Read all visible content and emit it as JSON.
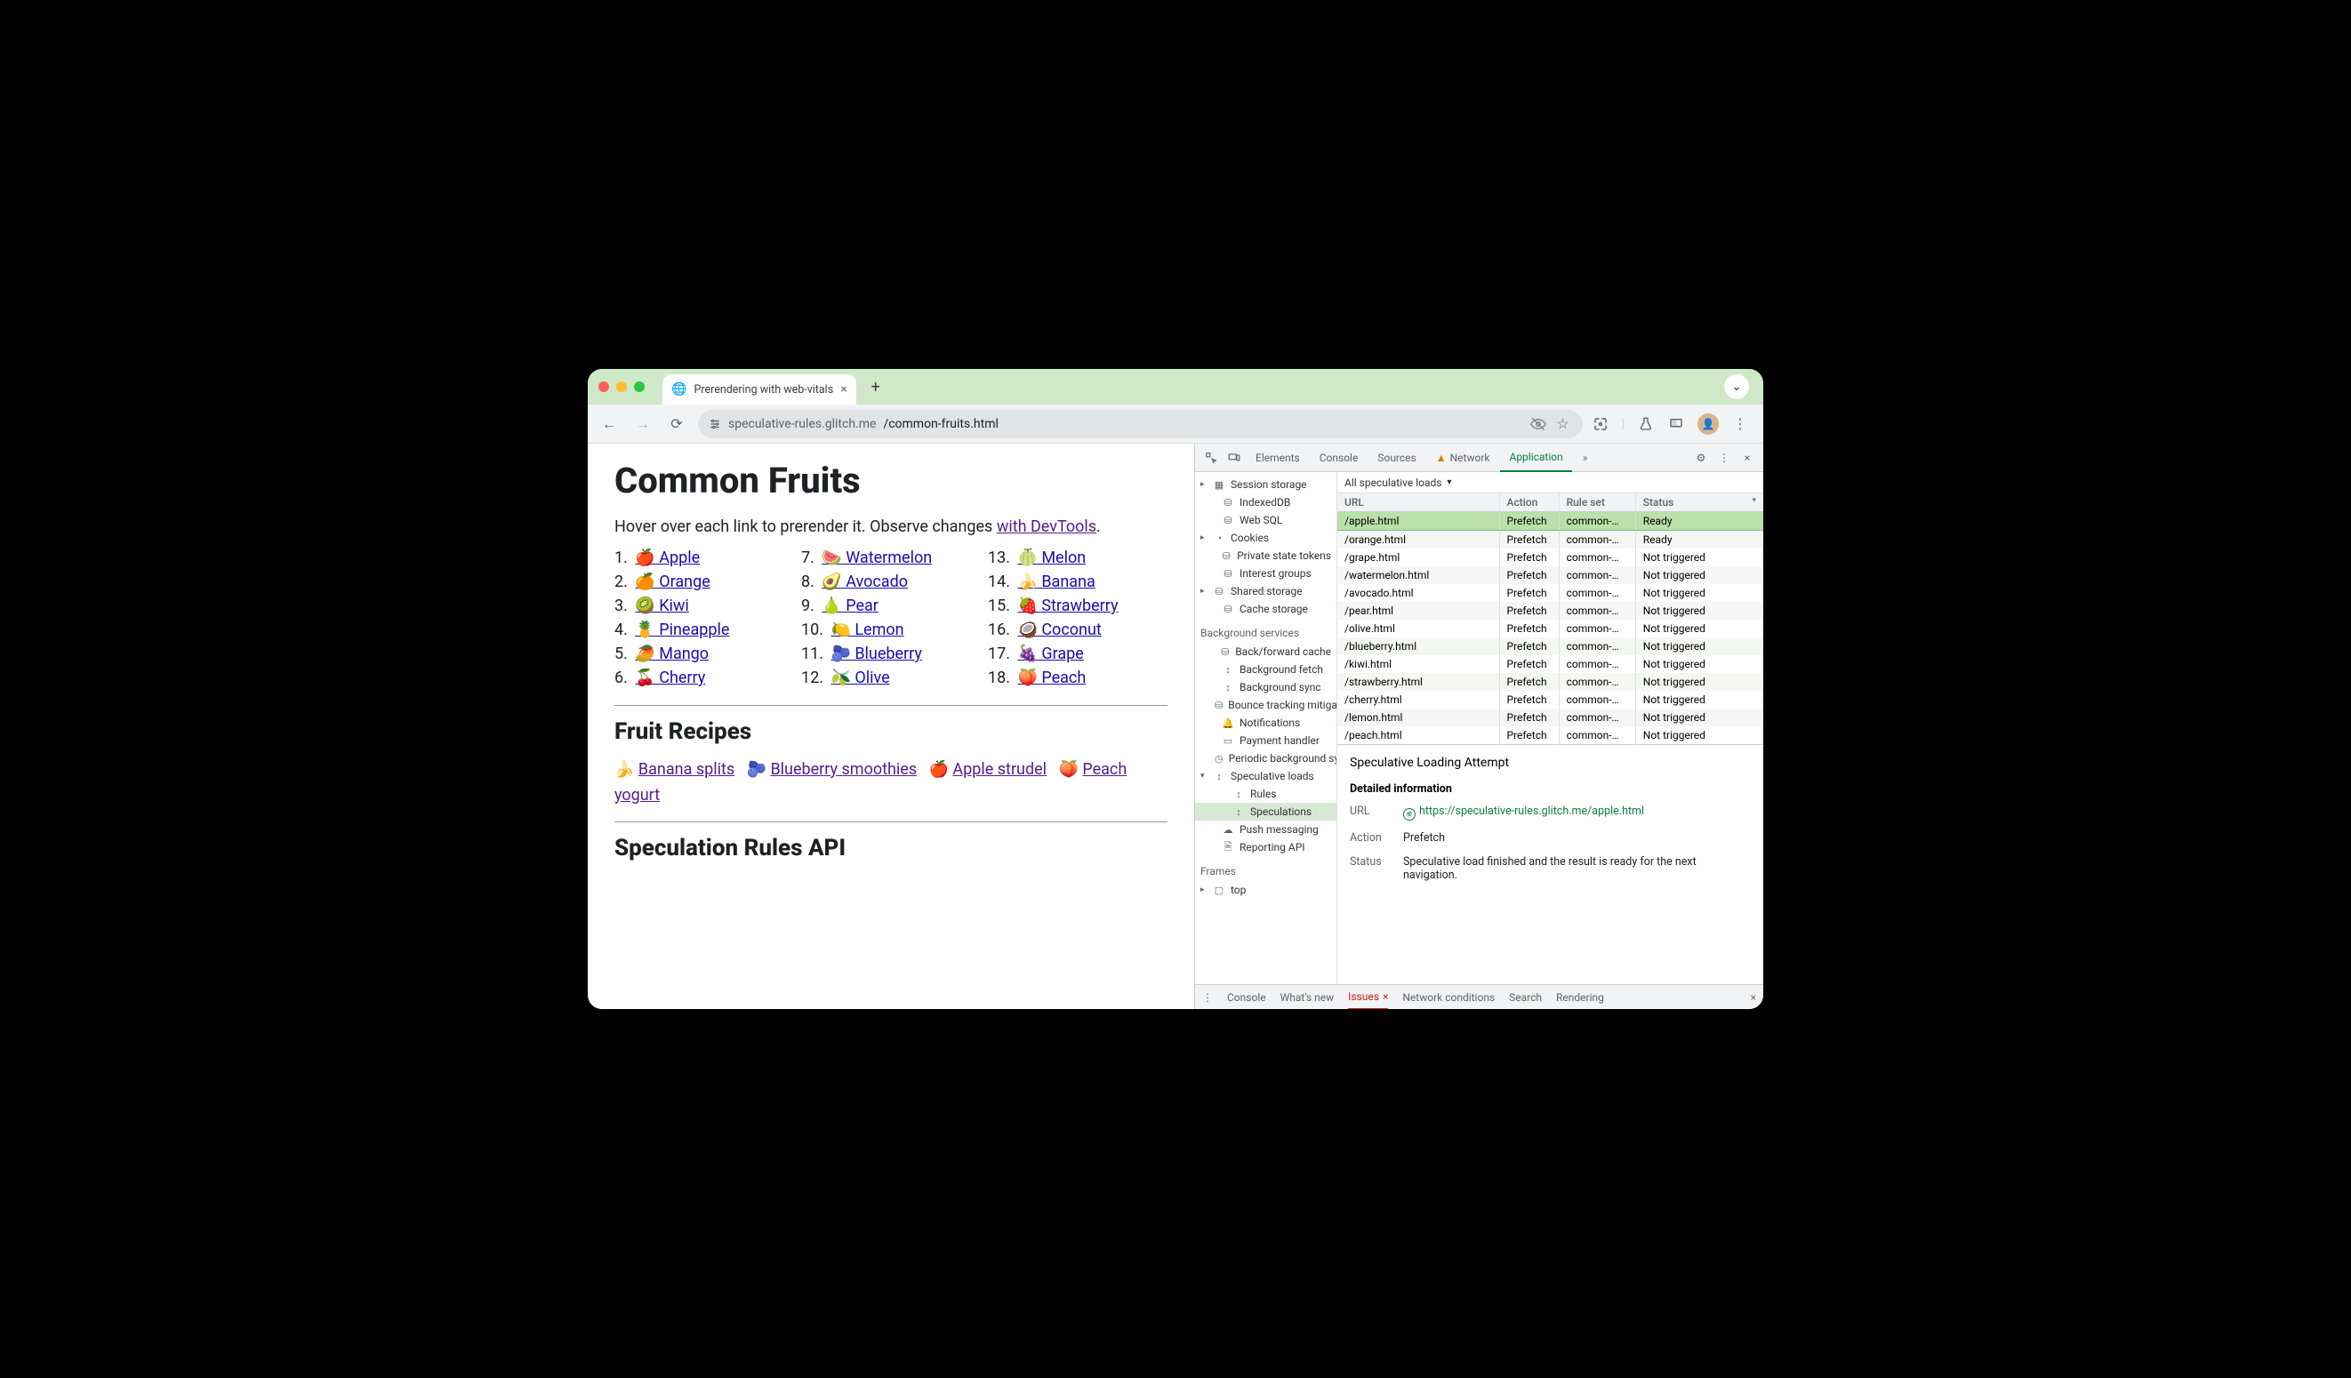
{
  "window": {
    "tab_title": "Prerendering with web-vitals",
    "url_prefix": "speculative-rules.glitch.me",
    "url_path": "/common-fruits.html"
  },
  "page": {
    "h1": "Common Fruits",
    "intro_a": "Hover over each link to prerender it. Observe changes ",
    "intro_link": "with DevTools",
    "intro_b": ".",
    "fruits": [
      {
        "n": "1.",
        "e": "🍎",
        "t": "Apple"
      },
      {
        "n": "2.",
        "e": "🍊",
        "t": "Orange"
      },
      {
        "n": "3.",
        "e": "🥝",
        "t": "Kiwi"
      },
      {
        "n": "4.",
        "e": "🍍",
        "t": "Pineapple"
      },
      {
        "n": "5.",
        "e": "🥭",
        "t": "Mango"
      },
      {
        "n": "6.",
        "e": "🍒",
        "t": "Cherry"
      },
      {
        "n": "7.",
        "e": "🍉",
        "t": "Watermelon"
      },
      {
        "n": "8.",
        "e": "🥑",
        "t": "Avocado"
      },
      {
        "n": "9.",
        "e": "🍐",
        "t": "Pear"
      },
      {
        "n": "10.",
        "e": "🍋",
        "t": "Lemon"
      },
      {
        "n": "11.",
        "e": "🫐",
        "t": "Blueberry"
      },
      {
        "n": "12.",
        "e": "🫒",
        "t": "Olive"
      },
      {
        "n": "13.",
        "e": "🍈",
        "t": "Melon"
      },
      {
        "n": "14.",
        "e": "🍌",
        "t": "Banana"
      },
      {
        "n": "15.",
        "e": "🍓",
        "t": "Strawberry"
      },
      {
        "n": "16.",
        "e": "🥥",
        "t": "Coconut"
      },
      {
        "n": "17.",
        "e": "🍇",
        "t": "Grape"
      },
      {
        "n": "18.",
        "e": "🍑",
        "t": "Peach"
      }
    ],
    "h2_recipes": "Fruit Recipes",
    "recipes": [
      {
        "e": "🍌",
        "t": "Banana splits"
      },
      {
        "e": "🫐",
        "t": "Blueberry smoothies"
      },
      {
        "e": "🍎",
        "t": "Apple strudel"
      },
      {
        "e": "🍑",
        "t": "Peach yogurt"
      }
    ],
    "h2_spec": "Speculation Rules API"
  },
  "devtools": {
    "tabs": {
      "elements": "Elements",
      "console": "Console",
      "sources": "Sources",
      "network": "Network",
      "application": "Application",
      "more": "»"
    },
    "side": [
      {
        "lvl": 0,
        "caret": "▸",
        "icon": "grid",
        "label": "Session storage"
      },
      {
        "lvl": 1,
        "icon": "db",
        "label": "IndexedDB"
      },
      {
        "lvl": 1,
        "icon": "db",
        "label": "Web SQL"
      },
      {
        "lvl": 0,
        "caret": "▸",
        "icon": "cookie",
        "label": "Cookies"
      },
      {
        "lvl": 1,
        "icon": "db",
        "label": "Private state tokens"
      },
      {
        "lvl": 1,
        "icon": "db",
        "label": "Interest groups"
      },
      {
        "lvl": 0,
        "caret": "▸",
        "icon": "db",
        "label": "Shared storage"
      },
      {
        "lvl": 1,
        "icon": "db",
        "label": "Cache storage"
      }
    ],
    "bg_heading": "Background services",
    "bg": [
      {
        "icon": "db",
        "label": "Back/forward cache"
      },
      {
        "icon": "sync",
        "label": "Background fetch"
      },
      {
        "icon": "sync",
        "label": "Background sync"
      },
      {
        "icon": "db",
        "label": "Bounce tracking mitigations"
      },
      {
        "icon": "bell",
        "label": "Notifications"
      },
      {
        "icon": "card",
        "label": "Payment handler"
      },
      {
        "icon": "clock",
        "label": "Periodic background sync"
      }
    ],
    "spec_parent": "Speculative loads",
    "spec_children": [
      "Rules",
      "Speculations"
    ],
    "after": [
      {
        "icon": "cloud",
        "label": "Push messaging"
      },
      {
        "icon": "doc",
        "label": "Reporting API"
      }
    ],
    "frames_heading": "Frames",
    "frames_top": "top",
    "filter_label": "All speculative loads",
    "columns": [
      "URL",
      "Action",
      "Rule set",
      "Status"
    ],
    "rows": [
      {
        "url": "/apple.html",
        "action": "Prefetch",
        "rule": "common-…",
        "status": "Ready",
        "sel": true
      },
      {
        "url": "/orange.html",
        "action": "Prefetch",
        "rule": "common-…",
        "status": "Ready"
      },
      {
        "url": "/grape.html",
        "action": "Prefetch",
        "rule": "common-…",
        "status": "Not triggered"
      },
      {
        "url": "/watermelon.html",
        "action": "Prefetch",
        "rule": "common-…",
        "status": "Not triggered"
      },
      {
        "url": "/avocado.html",
        "action": "Prefetch",
        "rule": "common-…",
        "status": "Not triggered"
      },
      {
        "url": "/pear.html",
        "action": "Prefetch",
        "rule": "common-…",
        "status": "Not triggered"
      },
      {
        "url": "/olive.html",
        "action": "Prefetch",
        "rule": "common-…",
        "status": "Not triggered"
      },
      {
        "url": "/blueberry.html",
        "action": "Prefetch",
        "rule": "common-…",
        "status": "Not triggered"
      },
      {
        "url": "/kiwi.html",
        "action": "Prefetch",
        "rule": "common-…",
        "status": "Not triggered"
      },
      {
        "url": "/strawberry.html",
        "action": "Prefetch",
        "rule": "common-…",
        "status": "Not triggered"
      },
      {
        "url": "/cherry.html",
        "action": "Prefetch",
        "rule": "common-…",
        "status": "Not triggered"
      },
      {
        "url": "/lemon.html",
        "action": "Prefetch",
        "rule": "common-…",
        "status": "Not triggered"
      },
      {
        "url": "/peach.html",
        "action": "Prefetch",
        "rule": "common-…",
        "status": "Not triggered"
      }
    ],
    "detail_title": "Speculative Loading Attempt",
    "detail_heading": "Detailed information",
    "detail": {
      "url_label": "URL",
      "url": "https://speculative-rules.glitch.me/apple.html",
      "action_label": "Action",
      "action": "Prefetch",
      "status_label": "Status",
      "status": "Speculative load finished and the result is ready for the next navigation."
    },
    "drawer": {
      "console": "Console",
      "whatsnew": "What's new",
      "issues": "Issues",
      "netcond": "Network conditions",
      "search": "Search",
      "rendering": "Rendering"
    }
  }
}
